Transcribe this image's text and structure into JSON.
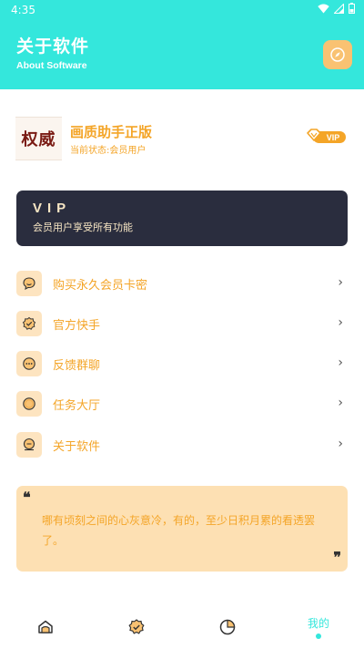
{
  "status_bar": {
    "time": "4:35"
  },
  "header": {
    "title": "关于软件",
    "subtitle": "About Software",
    "bg_color": "#34E7DC",
    "action_icon": "compass-icon"
  },
  "profile": {
    "logo_text": "权威",
    "app_name": "画质助手正版",
    "status": "当前状态:会员用户",
    "badge": "VIP"
  },
  "vip_card": {
    "title": "VIP",
    "description": "会员用户享受所有功能",
    "bg_color": "#2A2D3E"
  },
  "menu": {
    "items": [
      {
        "label": "购买永久会员卡密",
        "icon": "chat-icon"
      },
      {
        "label": "官方快手",
        "icon": "badge-check-icon"
      },
      {
        "label": "反馈群聊",
        "icon": "message-dots-icon"
      },
      {
        "label": "任务大厅",
        "icon": "circle-icon"
      },
      {
        "label": "关于软件",
        "icon": "info-coin-icon"
      }
    ],
    "chevron": "›"
  },
  "quote": {
    "open_mark": "❝",
    "close_mark": "❞",
    "text": "哪有顷刻之间的心灰意冷，有的，至少日积月累的看透罢了。"
  },
  "bottom_nav": {
    "items": [
      {
        "icon": "home-icon"
      },
      {
        "icon": "verified-icon"
      },
      {
        "icon": "pie-chart-icon"
      },
      {
        "label": "我的",
        "active": true
      }
    ],
    "accent_color": "#34E7DC"
  }
}
